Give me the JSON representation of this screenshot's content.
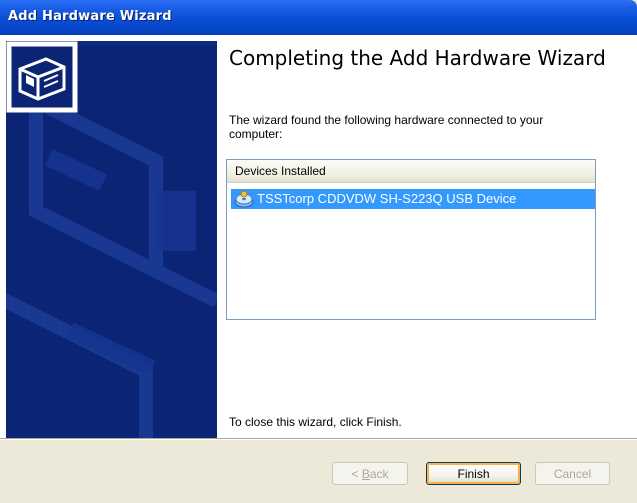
{
  "window": {
    "title": "Add Hardware Wizard"
  },
  "content": {
    "heading": "Completing the Add Hardware Wizard",
    "description": "The wizard found the following hardware connected to your computer:",
    "list_header": "Devices Installed",
    "devices": [
      {
        "name": "TSSTcorp CDDVDW SH-S223Q USB Device",
        "icon": "cd-drive-icon",
        "selected": true
      }
    ],
    "footer": "To close this wizard, click Finish."
  },
  "buttons": {
    "back_prefix": "< ",
    "back_access_key": "B",
    "back_rest": "ack",
    "finish": "Finish",
    "cancel": "Cancel"
  },
  "colors": {
    "titlebar": "#0a4ed6",
    "sidebar": "#0c2474",
    "selection": "#3399ff",
    "dialog_bg": "#ece9d8"
  }
}
